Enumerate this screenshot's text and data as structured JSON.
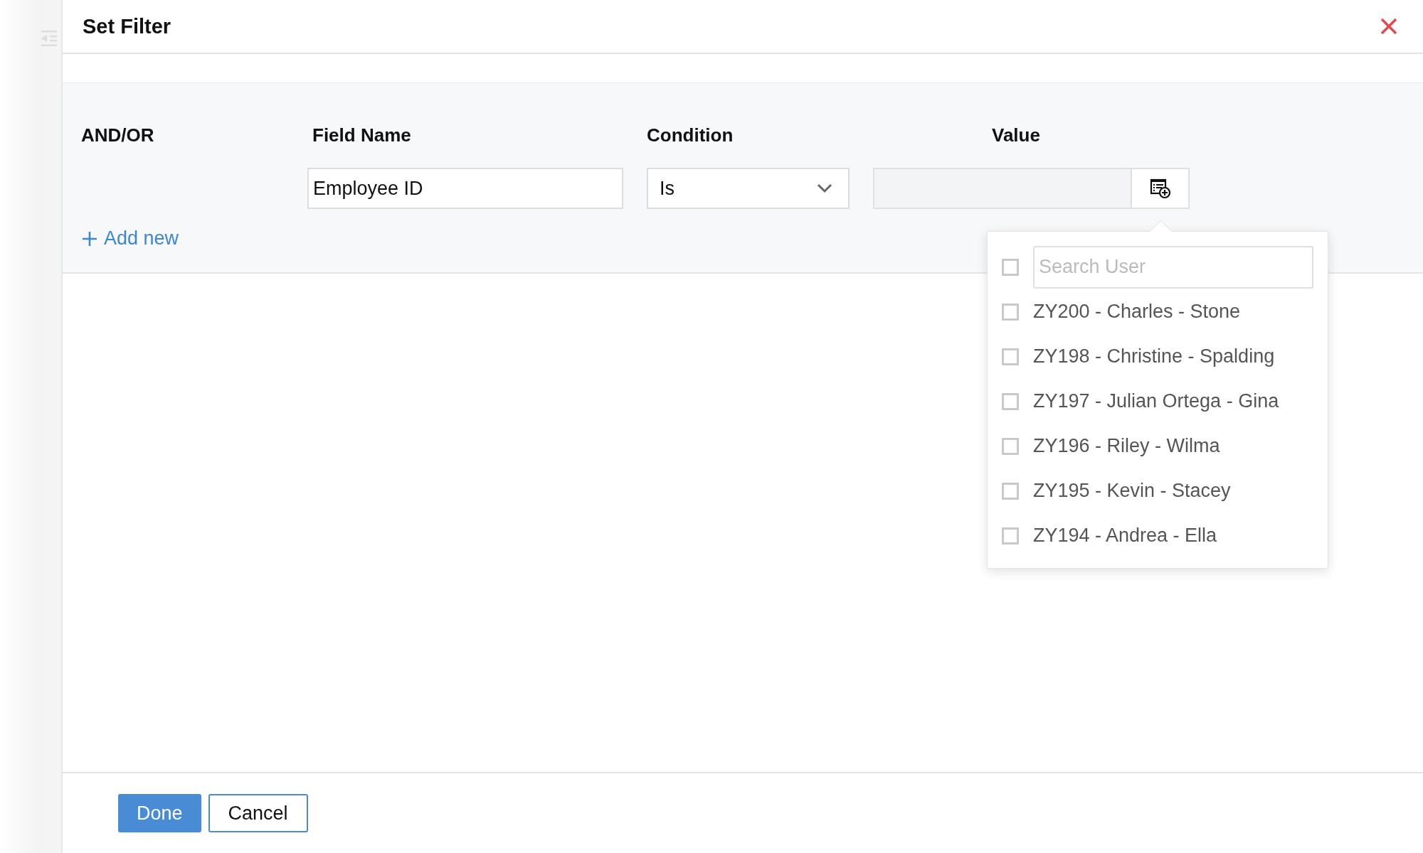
{
  "window": {
    "title": "Set Filter"
  },
  "columns": [
    "AND/OR",
    "Field Name",
    "Condition",
    "Value"
  ],
  "filter_row": {
    "field_name": "Employee ID",
    "condition": "Is"
  },
  "add_new": "Add new",
  "user_dropdown": {
    "search_placeholder": "Search User",
    "select_all_checked": false,
    "items": [
      {
        "label": "ZY200 - Charles - Stone",
        "checked": false
      },
      {
        "label": "ZY198 - Christine - Spalding",
        "checked": false
      },
      {
        "label": "ZY197 - Julian Ortega - Gina",
        "checked": false
      },
      {
        "label": "ZY196 - Riley - Wilma",
        "checked": false
      },
      {
        "label": "ZY195 - Kevin - Stacey",
        "checked": false
      },
      {
        "label": "ZY194 - Andrea - Ella",
        "checked": false
      }
    ]
  },
  "buttons": [
    {
      "label": "Done",
      "kind": "primary"
    },
    {
      "label": "Cancel",
      "kind": "secondary"
    }
  ]
}
